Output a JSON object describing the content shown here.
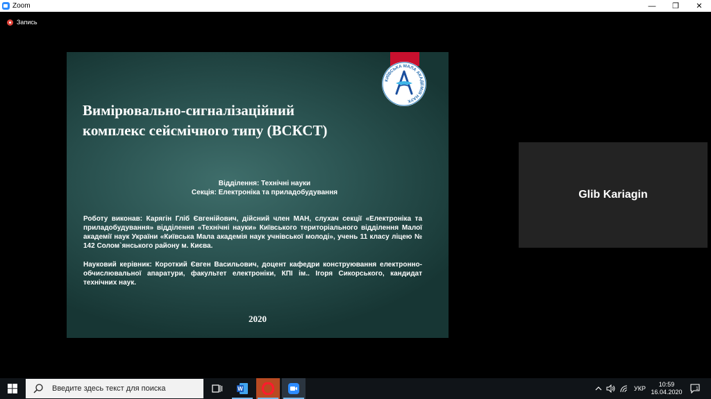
{
  "window": {
    "title": "Zoom",
    "controls": {
      "minimize": "—",
      "restore": "❐",
      "close": "✕"
    }
  },
  "recording": {
    "label": "Запись"
  },
  "slide": {
    "logo_text": "КИЇВСЬКА МАЛА АКАДЕМІЯ НАУК",
    "title": "Вимірювально-сигналізаційний комплекс сейсмічного типу (ВСКСТ)",
    "department": "Відділення: Технічні науки",
    "section": "Секція: Електроніка та приладобудування",
    "author_paragraph": "Роботу виконав: Карягін Гліб Євгенійович, дійсний член МАН, слухач секції «Електроніка та приладобудування» відділення «Технічні науки» Київського територіального відділення Малої академії наук України «Київська Мала академія наук учнівської молоді», учень 11 класу ліцею № 142 Солом`янського району м. Києва.",
    "supervisor_paragraph": "Науковий керівник: Короткий Євген Васильович, доцент кафедри конструювання електронно-обчислювальної апаратури, факультет електроніки, КПІ ім.. Ігоря Сикорського, кандидат технічних наук.",
    "year": "2020"
  },
  "participant": {
    "name": "Glib Kariagin"
  },
  "taskbar": {
    "search_placeholder": "Введите здесь текст для поиска",
    "apps": [
      "task-view",
      "word",
      "opera",
      "zoom"
    ],
    "language": "УКР",
    "time": "10:59",
    "date": "16.04.2020",
    "notifications_count": "1"
  },
  "colors": {
    "zoom_blue": "#2D8CFF",
    "slide_bg": "#2c5553",
    "ribbon_red": "#c8102e",
    "record_red": "#e0443a"
  }
}
